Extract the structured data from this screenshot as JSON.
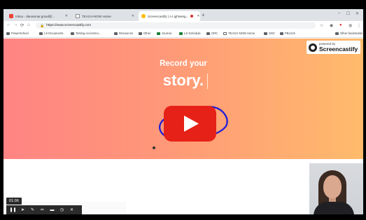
{
  "tabs": [
    {
      "title": "Inbox - danasmar.gmail@..."
    },
    {
      "title": "TEACH-NOW Home"
    },
    {
      "title": "Screencastify | A Lightweig..."
    }
  ],
  "address": {
    "url": "https://www.screencastify.com"
  },
  "bookmarks": [
    {
      "label": "PowerSchool"
    },
    {
      "label": "LS Documents"
    },
    {
      "label": "Testing Accommo..."
    },
    {
      "label": "Resources"
    },
    {
      "label": "Other"
    },
    {
      "label": "Journal"
    },
    {
      "label": "LS Schedule"
    },
    {
      "label": "GRC"
    },
    {
      "label": "TEACH-NOW Home"
    },
    {
      "label": "SOC"
    },
    {
      "label": "PBL/US"
    },
    {
      "label": "Other bookmarks"
    }
  ],
  "hero": {
    "line1": "Record your",
    "line2": "story."
  },
  "badge": {
    "prefix": "powered by",
    "brand": "Screencastify"
  },
  "recorder": {
    "timer": "01:06"
  },
  "colors": {
    "play_red": "#e62117",
    "scribble": "#1f1bd8",
    "hero_left": "#ff8483",
    "hero_right": "#ffbb6c"
  },
  "icons": [
    "pause-icon",
    "pointer-icon",
    "pen-icon",
    "highlighter-icon",
    "eraser-icon",
    "timer-icon",
    "close-icon"
  ]
}
